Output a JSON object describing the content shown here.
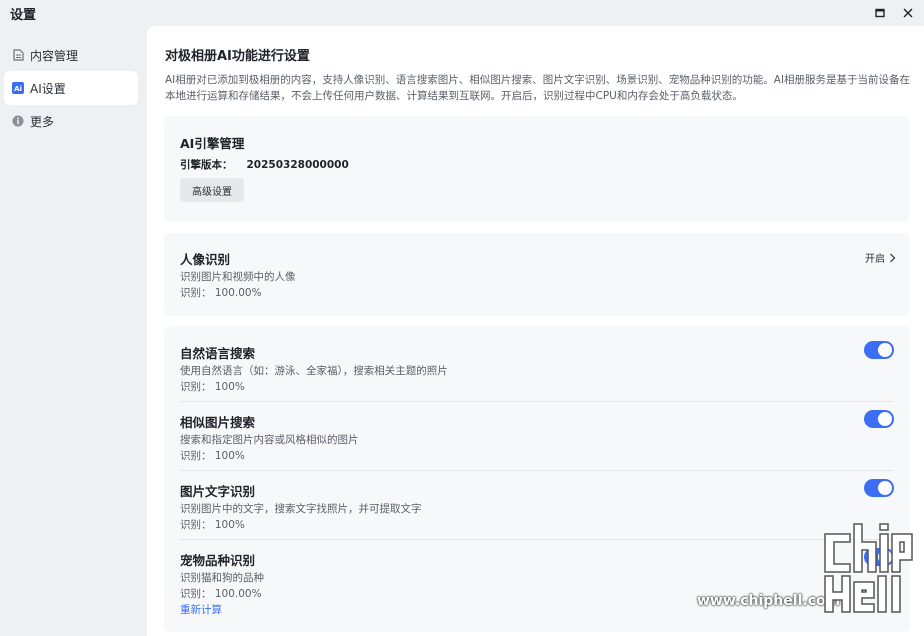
{
  "window": {
    "title": "设置"
  },
  "sidebar": {
    "items": [
      {
        "label": "内容管理",
        "icon": "document-icon",
        "active": false
      },
      {
        "label": "AI设置",
        "icon": "ai-icon",
        "active": true
      },
      {
        "label": "更多",
        "icon": "more-icon",
        "active": false
      }
    ]
  },
  "main": {
    "title": "对极相册AI功能进行设置",
    "intro": "AI相册对已添加到极相册的内容，支持人像识别、语言搜索图片、相似图片搜索、图片文字识别、场景识别、宠物品种识别的功能。AI相册服务是基于当前设备在本地进行运算和存储结果，不会上传任何用户数据、计算结果到互联网。开启后，识别过程中CPU和内存会处于高负载状态。",
    "engine": {
      "title": "AI引擎管理",
      "version_label": "引擎版本：",
      "version_value": "20250328000000",
      "advanced_button": "高级设置"
    },
    "portrait": {
      "title": "人像识别",
      "desc": "识别图片和视频中的人像",
      "stat": "识别： 100.00%",
      "status_label": "开启"
    },
    "features": [
      {
        "title": "自然语言搜索",
        "desc": "使用自然语言（如：游泳、全家福），搜索相关主题的照片",
        "stat": "识别： 100%",
        "enabled": true
      },
      {
        "title": "相似图片搜索",
        "desc": "搜索和指定图片内容或风格相似的图片",
        "stat": "识别： 100%",
        "enabled": true
      },
      {
        "title": "图片文字识别",
        "desc": "识别图片中的文字，搜索文字找照片，并可提取文字",
        "stat": "识别： 100%",
        "enabled": true
      },
      {
        "title": "宠物品种识别",
        "desc": "识别猫和狗的品种",
        "stat": "识别： 100.00%",
        "enabled": true,
        "action": "重新计算"
      }
    ]
  },
  "watermark": {
    "site": "www.chiphell.com",
    "logo_text": "chip hell"
  },
  "colors": {
    "accent": "#3b6ef5",
    "sidebar_bg": "#eef0f4",
    "card_bg": "#f7f8fa"
  }
}
